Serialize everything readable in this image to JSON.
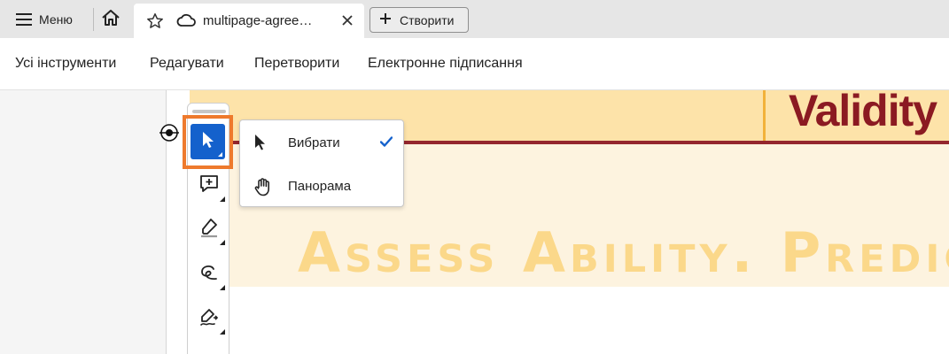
{
  "tabbar": {
    "menu_label": "Меню",
    "menu_icon": "hamburger-icon",
    "home_icon": "home-icon",
    "tab": {
      "title": "multipage-agree…",
      "star_icon": "star-icon",
      "cloud_icon": "cloud-icon",
      "close_icon": "close-icon"
    },
    "create_label": "Створити",
    "create_icon": "plus-icon"
  },
  "menubar": {
    "items": [
      "Усі інструменти",
      "Редагувати",
      "Перетворити",
      "Електронне підписання"
    ]
  },
  "toolbar": {
    "tools": [
      {
        "name": "select-tool",
        "icon": "cursor-arrow-icon",
        "active": true
      },
      {
        "name": "comment-tool",
        "icon": "add-comment-icon",
        "active": false
      },
      {
        "name": "highlight-tool",
        "icon": "highlighter-icon",
        "active": false
      },
      {
        "name": "draw-tool",
        "icon": "freehand-draw-icon",
        "active": false
      },
      {
        "name": "sign-tool",
        "icon": "pen-sign-icon",
        "active": false
      }
    ],
    "accent_color": "#1461CC",
    "highlight_color": "#EE7A2D"
  },
  "dropdown": {
    "options": [
      {
        "label": "Вибрати",
        "icon": "cursor-arrow-icon",
        "checked": true
      },
      {
        "label": "Панорама",
        "icon": "hand-pan-icon",
        "checked": false
      }
    ],
    "check_color": "#1461CC"
  },
  "document": {
    "header_word": "Validity",
    "slogan": "Assess Ability. Predic",
    "colors": {
      "top_band": "#FDE3A9",
      "main_band": "#FDF3DF",
      "maroon_rule": "#94262D",
      "header_text": "#8B1A22",
      "slogan_text": "#FBD88A"
    }
  }
}
